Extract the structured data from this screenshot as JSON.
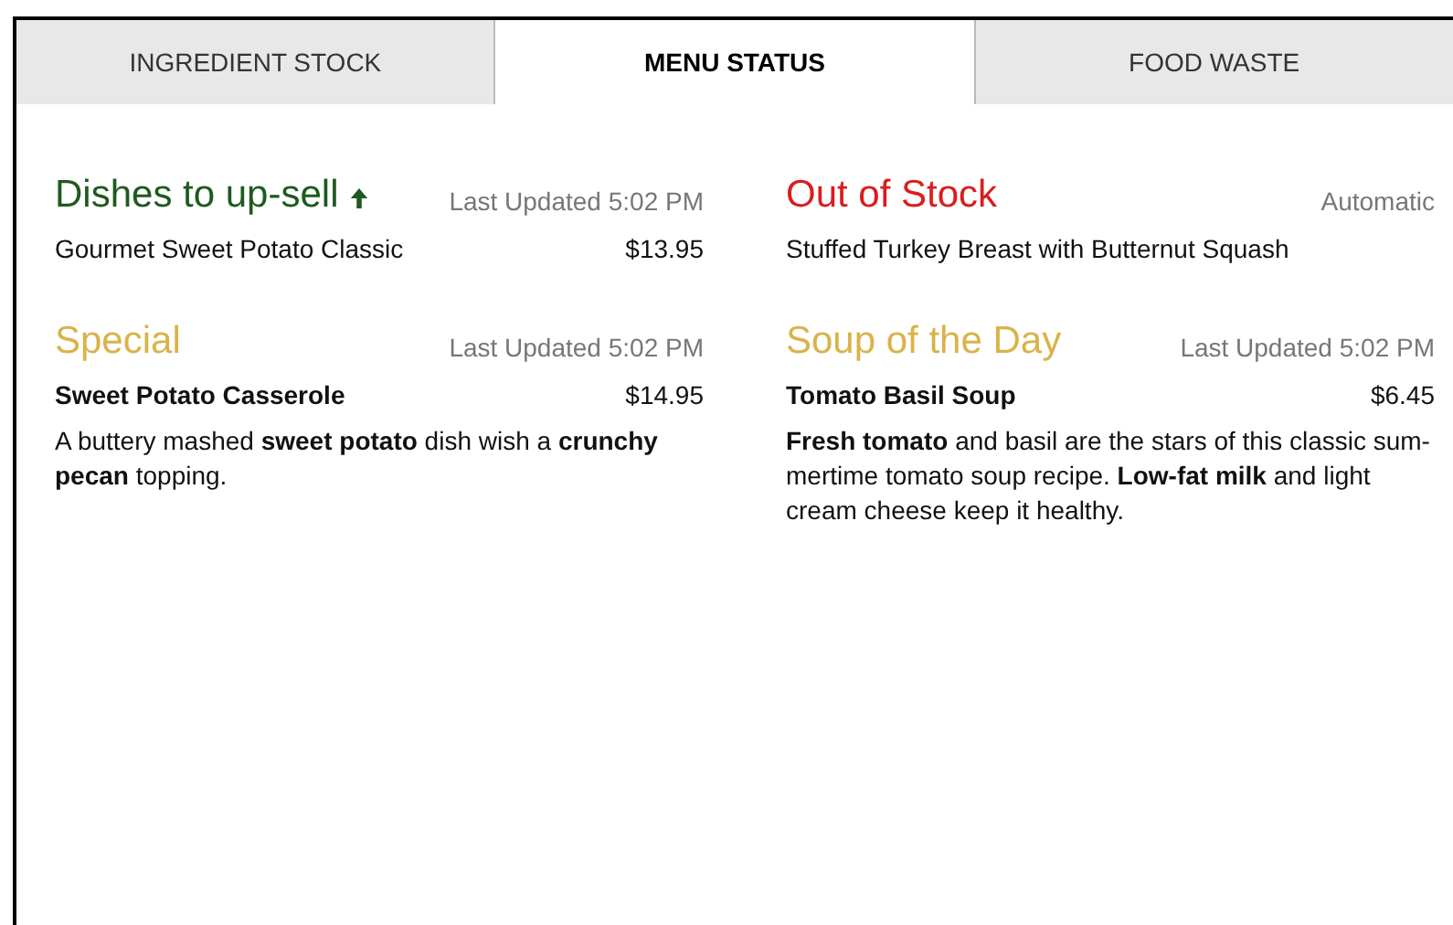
{
  "tabs": [
    {
      "label": "INGREDIENT STOCK",
      "selected": false
    },
    {
      "label": "MENU STATUS",
      "selected": true
    },
    {
      "label": "FOOD WASTE",
      "selected": false
    }
  ],
  "sections": [
    {
      "title": "Dishes to up-sell",
      "trending_up": true,
      "color": "#1e5a1e",
      "meta": "Last Updated 5:02 PM",
      "kind": "plain",
      "item": "Gourmet Sweet Potato Classic",
      "price": "$13.95"
    },
    {
      "title": "Out of Stock",
      "trending_up": false,
      "color": "#d81e1e",
      "meta": "Automatic",
      "kind": "plain",
      "item": "Stuffed Turkey Breast with Butternut Squash"
    },
    {
      "title": "Special",
      "trending_up": false,
      "color": "#d9b34a",
      "meta": "Last Updated 5:02 PM",
      "kind": "featured",
      "item": "Sweet Potato Casserole",
      "price": "$14.95",
      "description": "A buttery mashed **sweet potato** dish wish a **crunchy pecan** topping."
    },
    {
      "title": "Soup of the Day",
      "trending_up": false,
      "color": "#d9b34a",
      "meta": "Last Updated 5:02 PM",
      "kind": "featured",
      "item": "Tomato Basil Soup",
      "price": "$6.45",
      "description": "**Fresh tomato** and basil are the stars of this classic sum-mertime tomato soup recipe. **Low-fat milk** and light cream cheese keep it healthy."
    }
  ]
}
